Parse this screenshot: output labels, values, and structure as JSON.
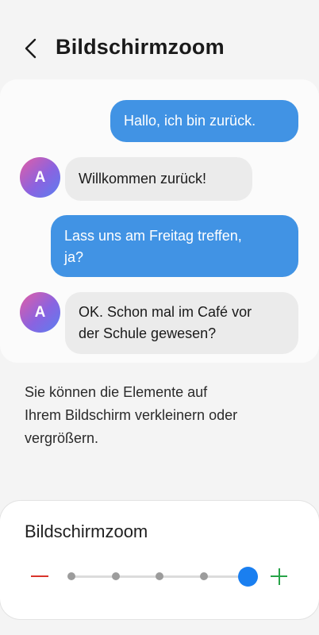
{
  "header": {
    "back_icon": "chevron-left-icon",
    "title": "Bildschirmzoom"
  },
  "preview": {
    "messages": [
      {
        "direction": "outgoing",
        "text": "Hallo, ich bin zurück."
      },
      {
        "direction": "incoming",
        "avatar": "A",
        "text": "Willkommen zurück!"
      },
      {
        "direction": "outgoing",
        "text": "Lass uns am Freitag treffen,\nja?"
      },
      {
        "direction": "incoming",
        "avatar": "A",
        "text": "OK. Schon mal im Café vor\nder Schule gewesen?"
      }
    ],
    "colors": {
      "outgoing_bubble": "#4193e4",
      "incoming_bubble": "#ebebeb"
    }
  },
  "description": "Sie können die Elemente auf\nIhrem Bildschirm verkleinern oder\nvergrößern.",
  "zoom": {
    "title": "Bildschirmzoom",
    "minus_icon": "minus-icon",
    "plus_icon": "plus-icon",
    "steps": 5,
    "selected_step": 5,
    "colors": {
      "thumb": "#1a7ff0",
      "minus": "#d9342b",
      "plus": "#27a348"
    }
  }
}
